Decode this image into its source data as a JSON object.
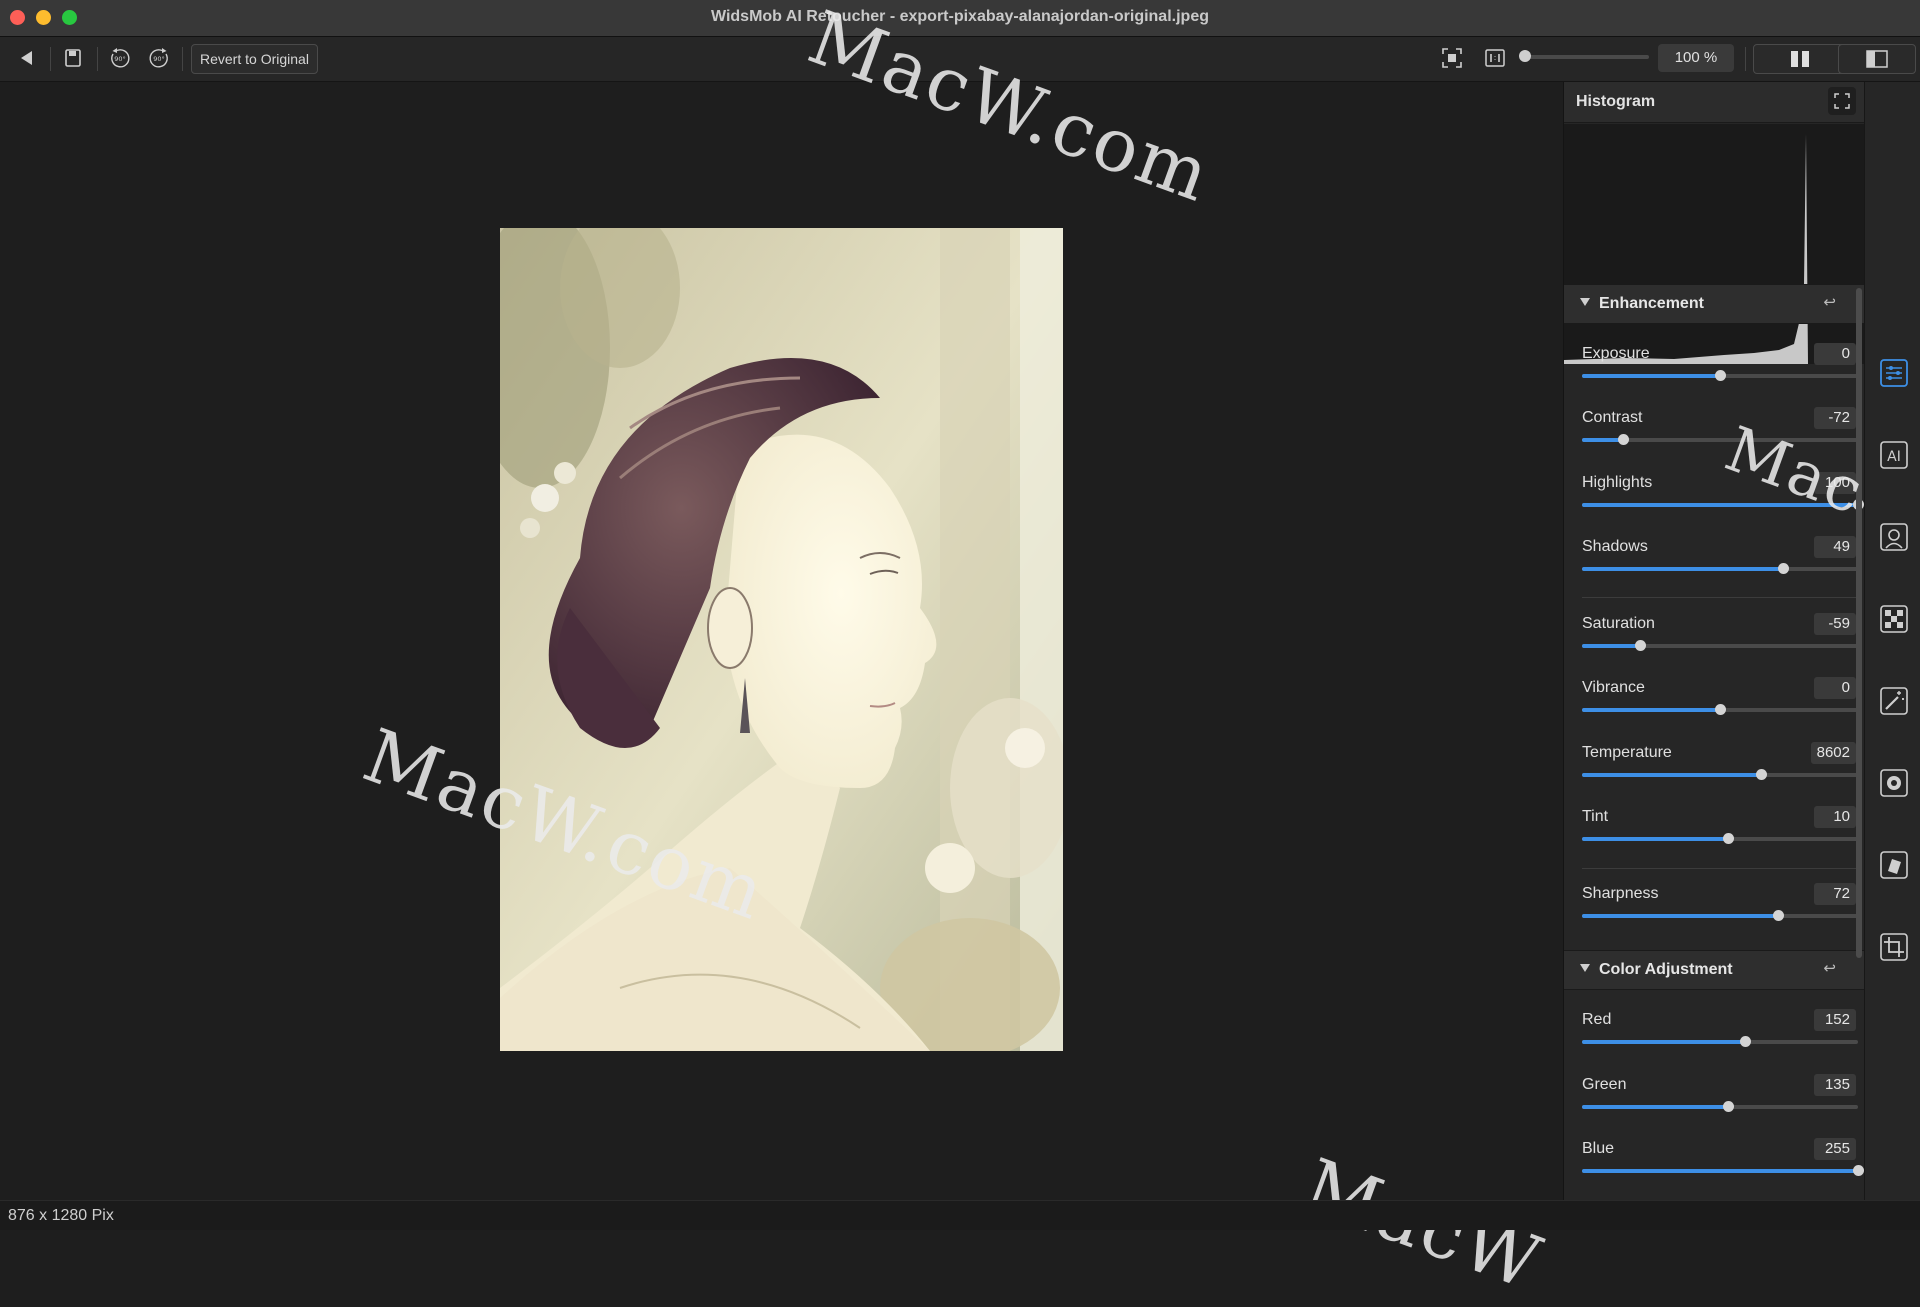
{
  "window": {
    "title": "WidsMob AI Retoucher - export-pixabay-alanajordan-original.jpeg"
  },
  "toolbar": {
    "back_icon": "back-arrow-icon",
    "save_icon": "save-icon",
    "rotate_left_label": "90°",
    "rotate_right_label": "90°",
    "revert_label": "Revert to Original",
    "zoom_value": "100 %",
    "zoom_level": 0.0
  },
  "canvas": {
    "watermarks": [
      "MacW.com",
      "MacW.com",
      "MacW.co",
      "MacW"
    ]
  },
  "status": {
    "dimensions": "876 x 1280 Pix"
  },
  "panel": {
    "histogram_title": "Histogram",
    "enhancement": {
      "title": "Enhancement",
      "sliders": [
        {
          "name": "Exposure",
          "value": "0",
          "level": 0.5
        },
        {
          "name": "Contrast",
          "value": "-72",
          "level": 0.15
        },
        {
          "name": "Highlights",
          "value": "100",
          "level": 1.0
        },
        {
          "name": "Shadows",
          "value": "49",
          "level": 0.73
        },
        {
          "name": "Saturation",
          "value": "-59",
          "level": 0.21
        },
        {
          "name": "Vibrance",
          "value": "0",
          "level": 0.5
        },
        {
          "name": "Temperature",
          "value": "8602",
          "level": 0.65
        },
        {
          "name": "Tint",
          "value": "10",
          "level": 0.53
        },
        {
          "name": "Sharpness",
          "value": "72",
          "level": 0.71
        }
      ]
    },
    "color_adjustment": {
      "title": "Color Adjustment",
      "sliders": [
        {
          "name": "Red",
          "value": "152",
          "level": 0.59
        },
        {
          "name": "Green",
          "value": "135",
          "level": 0.53
        },
        {
          "name": "Blue",
          "value": "255",
          "level": 1.0
        }
      ]
    }
  },
  "rail": {
    "tools": [
      "adjust-sliders-icon",
      "ai-icon",
      "portrait-icon",
      "noise-icon",
      "magic-wand-icon",
      "settings-gear-icon",
      "layers-icon",
      "crop-icon"
    ],
    "active": "adjust-sliders-icon",
    "ai_label": "AI"
  },
  "colors": {
    "accent": "#3d8fe6",
    "background": "#1e1e1e",
    "panel": "#262626"
  }
}
